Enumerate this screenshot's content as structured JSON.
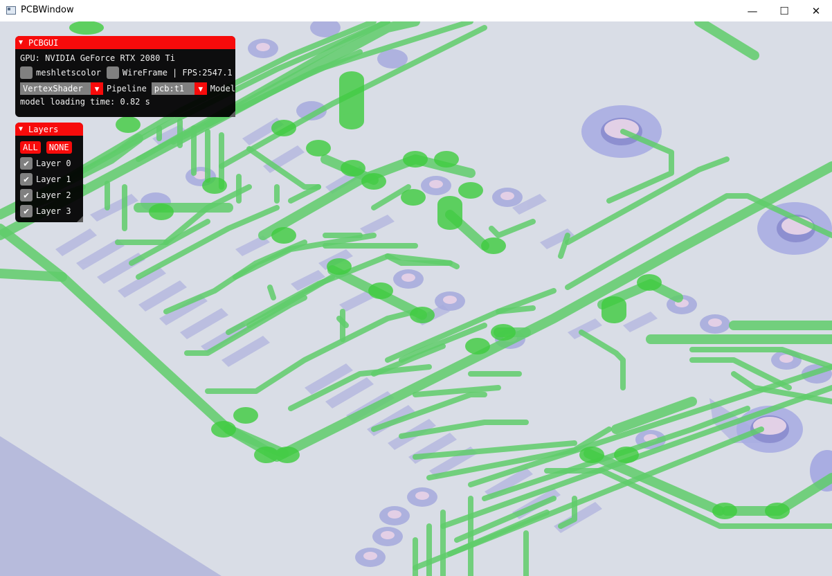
{
  "window": {
    "title": "PCBWindow",
    "minimize_glyph": "—",
    "maximize_glyph": "☐",
    "close_glyph": "✕"
  },
  "pcbgui": {
    "title": "PCBGUI",
    "gpu_label": "GPU: NVIDIA GeForce RTX 2080 Ti",
    "meshlets_label": "meshletscolor",
    "wireframe_label": "WireFrame",
    "fps_text": "| FPS:2547.1",
    "shader_value": "VertexShader",
    "pipeline_label": "Pipeline",
    "model_value": "pcb:t1",
    "model_label": "Model",
    "loading_text": "model loading time: 0.82 s"
  },
  "layers": {
    "title": "Layers",
    "all_label": "ALL",
    "none_label": "NONE",
    "items": [
      {
        "label": "Layer 0",
        "checked": true
      },
      {
        "label": "Layer 1",
        "checked": true
      },
      {
        "label": "Layer 2",
        "checked": true
      },
      {
        "label": "Layer 3",
        "checked": true
      }
    ]
  },
  "colors": {
    "accent_red": "#f70b0b",
    "trace_green": "#5fcc6a",
    "pad_blue": "#a8aede",
    "board_bg": "#d9dde6"
  }
}
